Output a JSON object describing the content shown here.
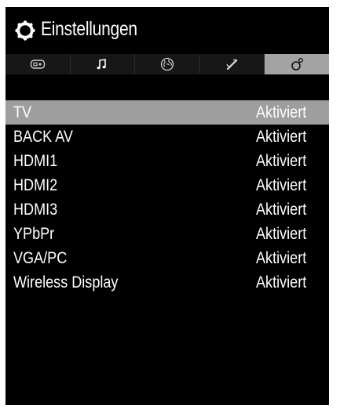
{
  "header": {
    "title": "Einstellungen",
    "icon": "gear-icon"
  },
  "tabs": [
    {
      "icon": "av-source-icon",
      "active": false
    },
    {
      "icon": "music-note-icon",
      "active": false
    },
    {
      "icon": "globe-icon",
      "active": false
    },
    {
      "icon": "tools-icon",
      "active": false
    },
    {
      "icon": "settings-icon",
      "active": true
    }
  ],
  "sources": [
    {
      "label": "TV",
      "value": "Aktiviert",
      "selected": true
    },
    {
      "label": "BACK AV",
      "value": "Aktiviert",
      "selected": false
    },
    {
      "label": "HDMI1",
      "value": "Aktiviert",
      "selected": false
    },
    {
      "label": "HDMI2",
      "value": "Aktiviert",
      "selected": false
    },
    {
      "label": "HDMI3",
      "value": "Aktiviert",
      "selected": false
    },
    {
      "label": "YPbPr",
      "value": "Aktiviert",
      "selected": false
    },
    {
      "label": "VGA/PC",
      "value": "Aktiviert",
      "selected": false
    },
    {
      "label": "Wireless Display",
      "value": "Aktiviert",
      "selected": false
    }
  ],
  "colors": {
    "background": "#000000",
    "tab_bar": "#171717",
    "highlight": "#9e9e9e",
    "text": "#ffffff"
  }
}
